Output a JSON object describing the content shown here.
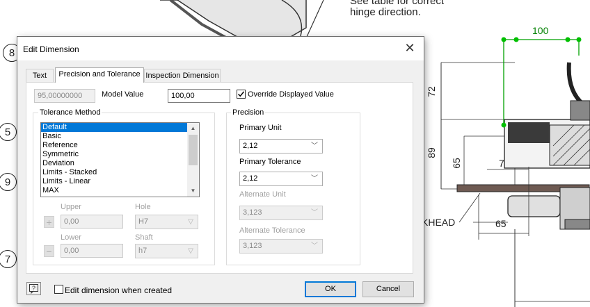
{
  "background": {
    "note_lines": [
      "See table for correct",
      "hinge direction."
    ],
    "dimensions": {
      "top": "100",
      "v72": "72",
      "v89": "89",
      "v65": "65",
      "h7": "7",
      "bottom65": "65"
    },
    "callout": "KHEAD",
    "balloons": [
      "8",
      "5",
      "9",
      "7"
    ]
  },
  "dialog": {
    "title": "Edit Dimension",
    "tabs": [
      {
        "label": "Text"
      },
      {
        "label": "Precision and Tolerance"
      },
      {
        "label": "Inspection Dimension"
      }
    ],
    "model_value": {
      "readout": "95,00000000",
      "label": "Model Value",
      "input": "100,00"
    },
    "override_label": "Override Displayed Value",
    "tolerance_method": {
      "label": "Tolerance Method",
      "items": [
        "Default",
        "Basic",
        "Reference",
        "Symmetric",
        "Deviation",
        "Limits - Stacked",
        "Limits - Linear",
        "MAX"
      ],
      "selected": "Default"
    },
    "upper": {
      "label": "Upper",
      "value": "0,00"
    },
    "lower": {
      "label": "Lower",
      "value": "0,00"
    },
    "hole": {
      "label": "Hole",
      "value": "H7"
    },
    "shaft": {
      "label": "Shaft",
      "value": "h7"
    },
    "precision": {
      "label": "Precision",
      "primary_unit": {
        "label": "Primary Unit",
        "value": "2,12"
      },
      "primary_tolerance": {
        "label": "Primary Tolerance",
        "value": "2,12"
      },
      "alternate_unit": {
        "label": "Alternate Unit",
        "value": "3,123"
      },
      "alternate_tolerance": {
        "label": "Alternate Tolerance",
        "value": "3,123"
      }
    },
    "footer": {
      "help_icon": "help-icon",
      "edit_when_created": "Edit dimension when created",
      "ok": "OK",
      "cancel": "Cancel"
    }
  },
  "colors": {
    "selection": "#0078d7",
    "annotation_red": "#e00000",
    "dimension_green": "#00a000"
  }
}
